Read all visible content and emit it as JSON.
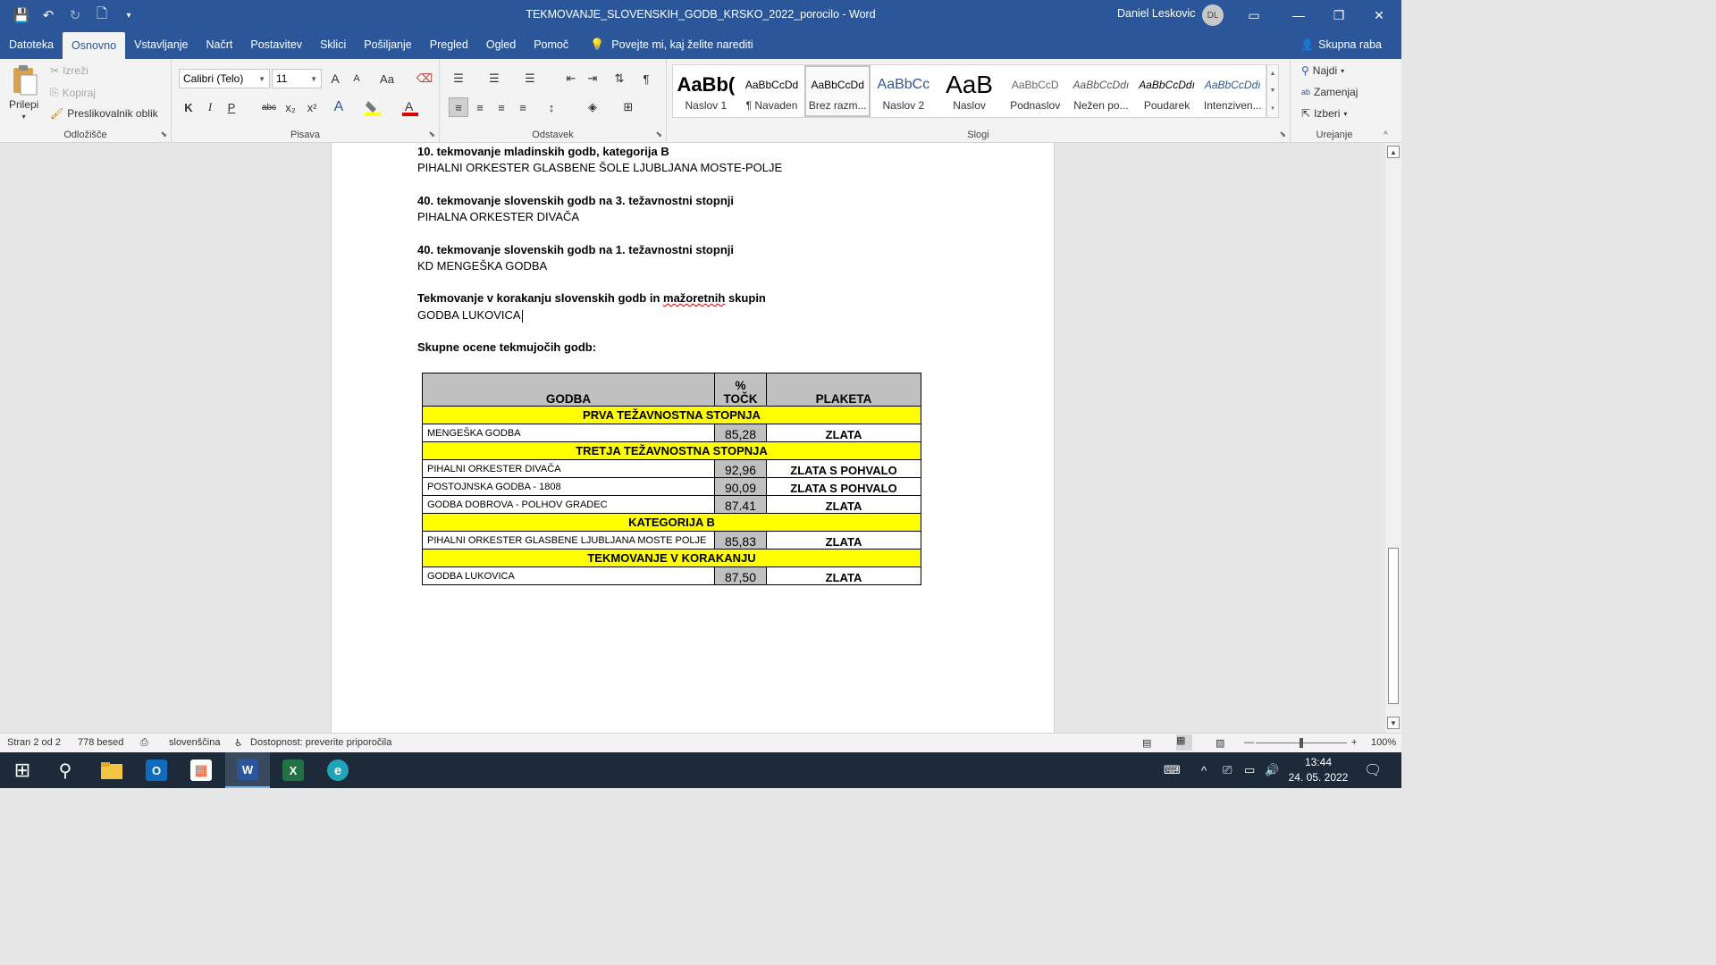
{
  "window": {
    "title": "TEKMOVANJE_SLOVENSKIH_GODB_KRSKO_2022_porocilo  -  Word",
    "user_name": "Daniel Leskovic",
    "user_initials": "DL"
  },
  "icons": {
    "save": "💾",
    "undo": "↶",
    "redo": "↻",
    "preview": "🗋",
    "customize": "▾",
    "ribbon_display": "▭",
    "minimize": "—",
    "restore": "❐",
    "close": "✕",
    "lightbulb": "💡",
    "share": "👤"
  },
  "menu": {
    "tabs": [
      "Datoteka",
      "Osnovno",
      "Vstavljanje",
      "Načrt",
      "Postavitev",
      "Sklici",
      "Pošiljanje",
      "Pregled",
      "Ogled",
      "Pomoč"
    ],
    "tell_me": "Povejte mi, kaj želite narediti",
    "share": "Skupna raba"
  },
  "ribbon": {
    "clipboard": {
      "label": "Odložišče",
      "paste": "Prilepi",
      "cut": "Izreži",
      "copy": "Kopiraj",
      "format_painter": "Preslikovalnik oblik"
    },
    "font": {
      "label": "Pisava",
      "font_name": "Calibri (Telo)",
      "font_size": "11",
      "bold": "K",
      "italic": "I",
      "underline": "P",
      "strike": "abc",
      "subscript": "x₂",
      "superscript": "x²",
      "grow": "A",
      "shrink": "A",
      "case": "Aa"
    },
    "paragraph": {
      "label": "Odstavek",
      "pilcrow": "¶"
    },
    "styles": {
      "label": "Slogi",
      "items": [
        {
          "sample": "AaBb(",
          "name": "Naslov 1"
        },
        {
          "sample": "AaBbCcDd",
          "name": "¶ Navaden"
        },
        {
          "sample": "AaBbCcDd",
          "name": "Brez razm..."
        },
        {
          "sample": "AaBbCc",
          "name": "Naslov 2"
        },
        {
          "sample": "AaB",
          "name": "Naslov"
        },
        {
          "sample": "AaBbCcD",
          "name": "Podnaslov"
        },
        {
          "sample": "AaBbCcDdı",
          "name": "Nežen po..."
        },
        {
          "sample": "AaBbCcDdı",
          "name": "Poudarek"
        },
        {
          "sample": "AaBbCcDdı",
          "name": "Intenziven..."
        }
      ]
    },
    "editing": {
      "label": "Urejanje",
      "find": "Najdi",
      "replace": "Zamenjaj",
      "select": "Izberi"
    }
  },
  "document": {
    "paragraphs": [
      {
        "text": "10. tekmovanje mladinskih godb, kategorija B",
        "bold": true
      },
      {
        "text": "PIHALNI ORKESTER GLASBENE ŠOLE LJUBLJANA MOSTE-POLJE",
        "bold": false
      },
      {
        "text": "40. tekmovanje slovenskih godb na 3. težavnostni stopnji",
        "bold": true
      },
      {
        "text": "PIHALNA ORKESTER DIVAČA",
        "bold": false
      },
      {
        "text": "40. tekmovanje slovenskih godb na 1. težavnostni stopnji",
        "bold": true
      },
      {
        "text": "KD MENGEŠKA GODBA",
        "bold": false
      },
      {
        "text_before": "Tekmovanje v korakanju slovenskih godb in ",
        "text_squiggle": "mažoretnih",
        "text_after": " skupin",
        "bold": true
      },
      {
        "text": "GODBA LUKOVICA",
        "bold": false
      },
      {
        "text": "Skupne ocene tekmujočih godb:",
        "bold": true
      }
    ],
    "table": {
      "headers": [
        "GODBA",
        "%\nTOČK",
        "PLAKETA"
      ],
      "sections": [
        {
          "category": "PRVA TEŽAVNOSTNA STOPNJA",
          "rows": [
            {
              "name": "MENGEŠKA GODBA",
              "score": "85,28",
              "plaque": "ZLATA"
            }
          ]
        },
        {
          "category": "TRETJA TEŽAVNOSTNA STOPNJA",
          "rows": [
            {
              "name": "PIHALNI ORKESTER DIVAČA",
              "score": "92,96",
              "plaque": "ZLATA S POHVALO"
            },
            {
              "name": "POSTOJNSKA GODBA - 1808",
              "score": "90,09",
              "plaque": "ZLATA S POHVALO"
            },
            {
              "name": "GODBA DOBROVA - POLHOV GRADEC",
              "score": "87.41",
              "plaque": "ZLATA"
            }
          ]
        },
        {
          "category": "KATEGORIJA B",
          "rows": [
            {
              "name": "PIHALNI ORKESTER GLASBENE LJUBLJANA MOSTE POLJE",
              "score": "85,83",
              "plaque": "ZLATA"
            }
          ]
        },
        {
          "category": "TEKMOVANJE V KORAKANJU",
          "rows": [
            {
              "name": "GODBA LUKOVICA",
              "score": "87,50",
              "plaque": "ZLATA"
            }
          ]
        }
      ]
    }
  },
  "status": {
    "page": "Stran 2 od 2",
    "words": "778 besed",
    "language": "slovenščina",
    "accessibility": "Dostopnost: preverite priporočila",
    "zoom": "100%",
    "zoom_out": "—",
    "zoom_in": "+"
  },
  "taskbar": {
    "time": "13:44",
    "date": "24. 05. 2022",
    "apps": [
      {
        "name": "start",
        "glyph": "⊞"
      },
      {
        "name": "search",
        "glyph": "⚲"
      },
      {
        "name": "file-explorer",
        "glyph": ""
      },
      {
        "name": "outlook",
        "glyph": "O"
      },
      {
        "name": "store",
        "glyph": "▦"
      },
      {
        "name": "word",
        "glyph": "W"
      },
      {
        "name": "excel",
        "glyph": "X"
      },
      {
        "name": "edge",
        "glyph": "e"
      }
    ]
  },
  "colors": {
    "word_blue": "#2b579a",
    "category_yellow": "#ffff00",
    "table_grey": "#c0c0c0"
  }
}
